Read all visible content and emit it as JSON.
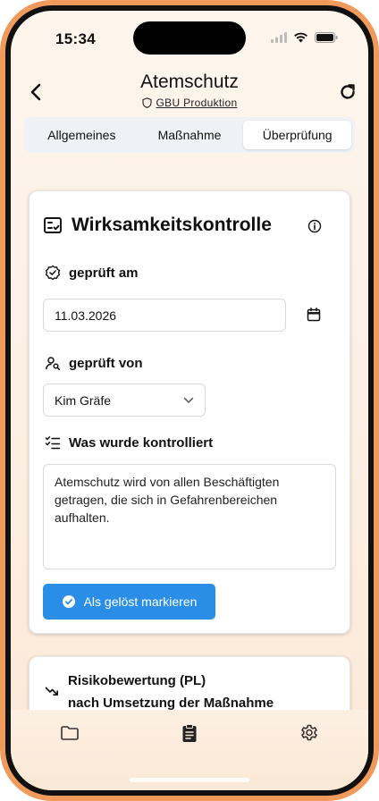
{
  "status": {
    "time": "15:34"
  },
  "header": {
    "title": "Atemschutz",
    "subtitle_link": "GBU Produktion"
  },
  "tabs": [
    {
      "label": "Allgemeines",
      "active": false
    },
    {
      "label": "Maßnahme",
      "active": false
    },
    {
      "label": "Überprüfung",
      "active": true
    }
  ],
  "card": {
    "title": "Wirksamkeitskontrolle",
    "checked_on_label": "geprüft am",
    "checked_on_value": "11.03.2026",
    "checked_by_label": "geprüft von",
    "checked_by_value": "Kim Gräfe",
    "what_checked_label": "Was wurde kontrolliert",
    "what_checked_value": "Atemschutz wird von allen Beschäftigten getragen, die sich in Gefahrenbereichen aufhalten.",
    "resolve_button": "Als gelöst markieren"
  },
  "card2": {
    "title_line1": "Risikobewertung (PL)",
    "title_line2": "nach Umsetzung der Maßnahme"
  },
  "colors": {
    "accent": "#2b8ee6",
    "frame": "#f09a5c"
  },
  "icons": [
    "back-icon",
    "shield-icon",
    "refresh-icon",
    "checklist-icon",
    "info-icon",
    "badge-check-icon",
    "calendar-icon",
    "user-search-icon",
    "chevron-down-icon",
    "list-check-icon",
    "check-circle-icon",
    "trend-down-icon",
    "folder-icon",
    "clipboard-icon",
    "gear-icon"
  ]
}
